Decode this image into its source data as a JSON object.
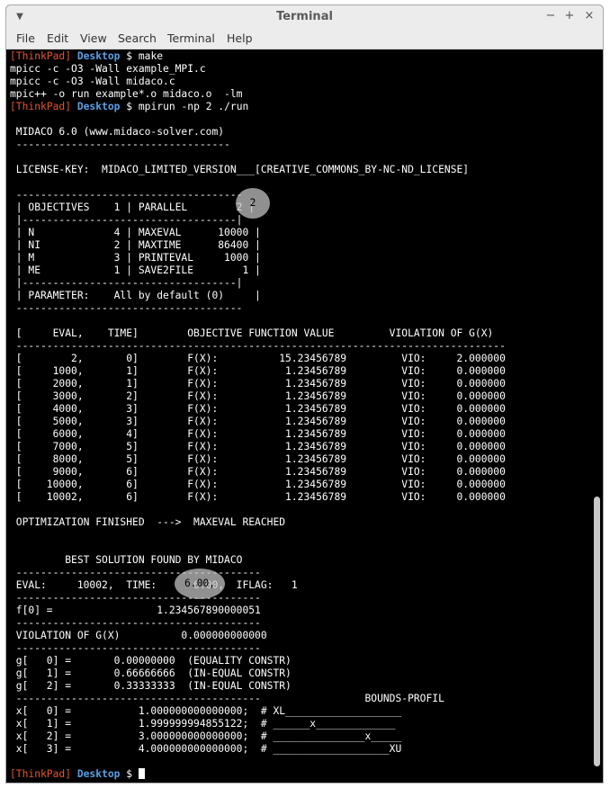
{
  "window": {
    "title": "Terminal",
    "menu_icon": "down-triangle-icon",
    "controls": [
      "minimize-icon",
      "maximize-icon",
      "close-icon"
    ],
    "control_glyphs": [
      "−",
      "+",
      "×"
    ]
  },
  "menubar": {
    "items": [
      "File",
      "Edit",
      "View",
      "Search",
      "Terminal",
      "Help"
    ]
  },
  "terminal": {
    "prompt": {
      "host": "[ThinkPad]",
      "dir": "Desktop",
      "symbol": "$"
    },
    "commands": {
      "make": "make",
      "mpirun": "mpirun -np 2 ./run"
    },
    "make_output": [
      "mpicc -c -O3 -Wall example_MPI.c",
      "mpicc -c -O3 -Wall midaco.c",
      "mpic++ -o run example*.o midaco.o  -lm"
    ],
    "program_output": [
      "",
      " MIDACO 6.0 (www.midaco-solver.com)",
      " -----------------------------------",
      "",
      " LICENSE-KEY:  MIDACO_LIMITED_VERSION___[CREATIVE_COMMONS_BY-NC-ND_LICENSE]",
      "",
      " -------------------------------------",
      " | OBJECTIVES    1 | PARALLEL        2 |",
      " |-----------------------------------|",
      " | N             4 | MAXEVAL      10000 |",
      " | NI            2 | MAXTIME      86400 |",
      " | M             3 | PRINTEVAL     1000 |",
      " | ME            1 | SAVE2FILE        1 |",
      " |-----------------------------------|",
      " | PARAMETER:    All by default (0)     |",
      " -------------------------------------",
      "",
      " [     EVAL,    TIME]        OBJECTIVE FUNCTION VALUE         VIOLATION OF G(X)",
      " --------------------------------------------------------------------------------",
      " [        2,       0]        F(X):          15.23456789         VIO:     2.000000",
      " [     1000,       1]        F(X):           1.23456789         VIO:     0.000000",
      " [     2000,       1]        F(X):           1.23456789         VIO:     0.000000",
      " [     3000,       2]        F(X):           1.23456789         VIO:     0.000000",
      " [     4000,       3]        F(X):           1.23456789         VIO:     0.000000",
      " [     5000,       3]        F(X):           1.23456789         VIO:     0.000000",
      " [     6000,       4]        F(X):           1.23456789         VIO:     0.000000",
      " [     7000,       5]        F(X):           1.23456789         VIO:     0.000000",
      " [     8000,       5]        F(X):           1.23456789         VIO:     0.000000",
      " [     9000,       6]        F(X):           1.23456789         VIO:     0.000000",
      " [    10000,       6]        F(X):           1.23456789         VIO:     0.000000",
      " [    10002,       6]        F(X):           1.23456789         VIO:     0.000000",
      "",
      " OPTIMIZATION FINISHED  --->  MAXEVAL REACHED",
      "",
      "",
      "         BEST SOLUTION FOUND BY MIDACO",
      " ----------------------------------------",
      " EVAL:     10002,  TIME:      6.00,  IFLAG:   1",
      " ----------------------------------------",
      " f[0] =                 1.234567890000051",
      " ----------------------------------------",
      " VIOLATION OF G(X)          0.000000000000",
      " ----------------------------------------",
      " g[   0] =       0.00000000  (EQUALITY CONSTR)",
      " g[   1] =       0.66666666  (IN-EQUAL CONSTR)",
      " g[   2] =       0.33333333  (IN-EQUAL CONSTR)",
      " ----------------------------------------                 BOUNDS-PROFIL",
      " x[   0] =           1.000000000000000;  # XL___________________",
      " x[   1] =           1.999999994855122;  # ______x_____________",
      " x[   2] =           3.000000000000000;  # _______________x_____",
      " x[   3] =           4.000000000000000;  # ___________________XU",
      ""
    ],
    "highlights": [
      "2",
      "6.00,"
    ]
  }
}
